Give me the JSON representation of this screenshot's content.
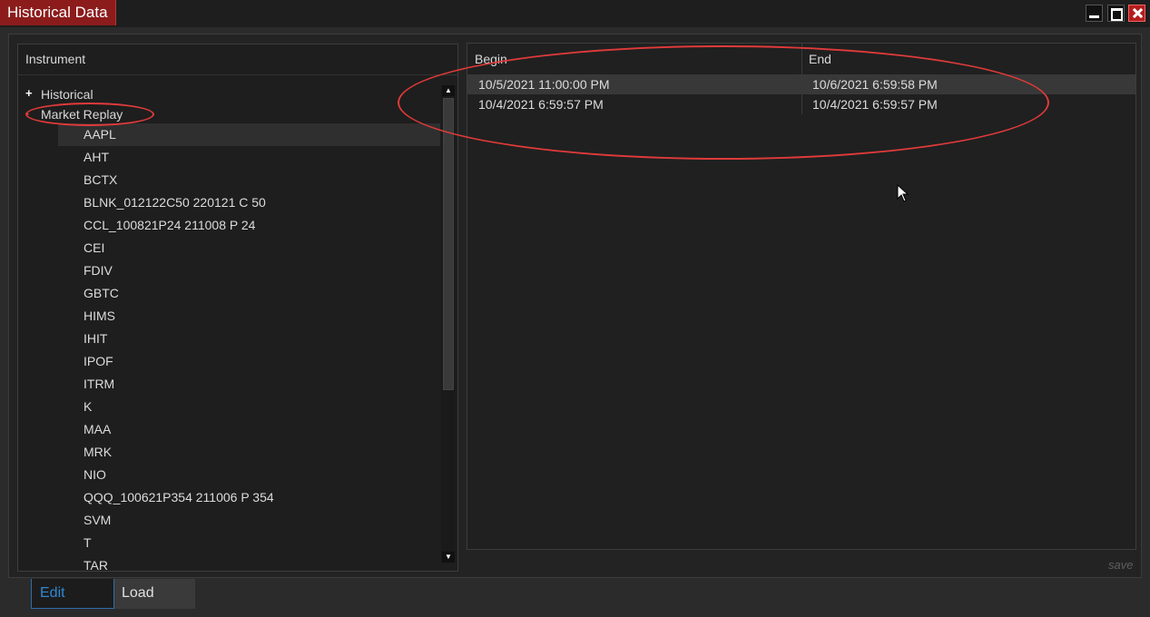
{
  "window": {
    "title": "Historical Data",
    "controls": [
      "minimize-icon",
      "maximize-icon",
      "close-icon"
    ]
  },
  "instrument_panel": {
    "header": "Instrument",
    "tree": [
      {
        "label": "Historical",
        "toggle": "+"
      },
      {
        "label": "Market Replay",
        "toggle": "-"
      }
    ],
    "items": [
      "AAPL",
      "AHT",
      "BCTX",
      "BLNK_012122C50 220121 C 50",
      "CCL_100821P24 211008 P 24",
      "CEI",
      "FDIV",
      "GBTC",
      "HIMS",
      "IHIT",
      "IPOF",
      "ITRM",
      "K",
      "MAA",
      "MRK",
      "NIO",
      "QQQ_100621P354 211006 P 354",
      "SVM",
      "T",
      "TAR"
    ],
    "selected_item": "AAPL"
  },
  "grid": {
    "columns": {
      "begin": "Begin",
      "end": "End"
    },
    "rows": [
      {
        "begin": "10/5/2021 11:00:00 PM",
        "end": "10/6/2021 6:59:58 PM"
      },
      {
        "begin": "10/4/2021 6:59:57 PM",
        "end": "10/4/2021 6:59:57 PM"
      }
    ]
  },
  "footer": {
    "save_label": "save",
    "tabs": {
      "edit": "Edit",
      "load": "Load"
    },
    "active_tab": "Edit"
  },
  "colors": {
    "title_tab": "#8c1c1c",
    "annotation": "#e03a3a",
    "active_tab_text": "#2f88d6",
    "background": "#2b2b2b"
  }
}
